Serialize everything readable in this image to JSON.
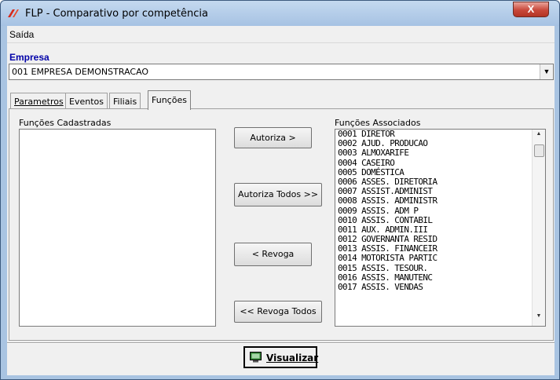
{
  "window": {
    "title": "FLP - Comparativo por competência",
    "close_glyph": "X"
  },
  "menu": {
    "items": [
      {
        "label": "Saída"
      }
    ]
  },
  "company": {
    "label": "Empresa",
    "value": "001 EMPRESA DEMONSTRACAO"
  },
  "tabs": [
    {
      "label": "Parametros",
      "active": false
    },
    {
      "label": "Eventos",
      "active": false
    },
    {
      "label": "Filiais",
      "active": false
    },
    {
      "label": "Funções",
      "active": true
    }
  ],
  "functions_panel": {
    "registered_label": "Funções Cadastradas",
    "associated_label": "Funções Associados",
    "associated_items": [
      "0001 DIRETOR",
      "0002 AJUD. PRODUCAO",
      "0003 ALMOXARIFE",
      "0004 CASEIRO",
      "0005 DOMÉSTICA",
      "0006 ASSES. DIRETORIA",
      "0007 ASSIST.ADMINIST",
      "0008 ASSIS. ADMINISTR",
      "0009 ASSIS. ADM P",
      "0010 ASSIS. CONTABIL",
      "0011 AUX. ADMIN.III",
      "0012 GOVERNANTA RESID",
      "0013 ASSIS. FINANCEIR",
      "0014 MOTORISTA PARTIC",
      "0015 ASSIS. TESOUR.",
      "0016 ASSIS. MANUTENC",
      "0017 ASSIS. VENDAS"
    ],
    "buttons": {
      "authorize": "Autoriza >",
      "authorize_all": "Autoriza Todos >>",
      "revoke": "< Revoga",
      "revoke_all": "<< Revoga Todos"
    }
  },
  "footer": {
    "view_button": "Visualizar"
  },
  "icons": {
    "app": "flp-logo-icon",
    "view": "monitor-icon",
    "dropdown": "chevron-down-icon"
  },
  "colors": {
    "company_label": "#0000a8",
    "close_button": "#c8483a"
  }
}
